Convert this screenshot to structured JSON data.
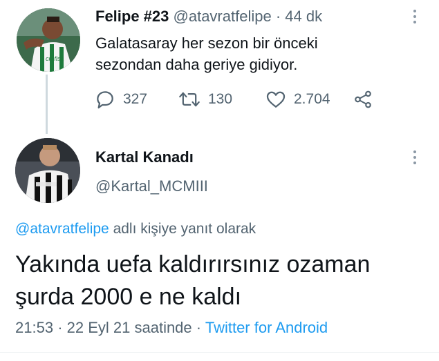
{
  "original_tweet": {
    "author_name": "Felipe #23",
    "author_handle": "@atavratfelipe",
    "separator": "·",
    "time_ago": "44 dk",
    "text_line1": "Galatasaray her sezon bir önceki",
    "text_line2": "sezondan daha geriye gidiyor.",
    "replies": "327",
    "retweets": "130",
    "likes": "2.704",
    "avatar_icon": "player-green-jersey-avatar",
    "more_icon": "more-options-icon"
  },
  "reply_tweet": {
    "author_name": "Kartal Kanadı",
    "author_handle": "@Kartal_MCMIII",
    "reply_to_handle": "@atavratfelipe",
    "reply_to_suffix": " adlı kişiye yanıt olarak",
    "text_line1": "Yakında uefa kaldırırsınız ozaman",
    "text_line2": "şurda 2000 e ne kaldı",
    "time": "21:53",
    "sep1": "·",
    "date": "22 Eyl 21 saatinde",
    "sep2": "·",
    "source": "Twitter for Android",
    "avatar_icon": "player-striped-jersey-avatar"
  },
  "colors": {
    "accent": "#1d9bf0",
    "muted": "#536471",
    "text": "#0f1419",
    "thread_line": "#cfd9de"
  }
}
